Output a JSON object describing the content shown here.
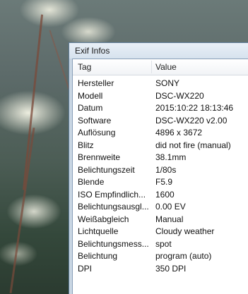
{
  "window": {
    "title": "Exif Infos"
  },
  "table": {
    "columns": [
      "Tag",
      "Value"
    ],
    "rows": [
      {
        "tag": "Hersteller",
        "value": "SONY"
      },
      {
        "tag": "Modell",
        "value": "DSC-WX220"
      },
      {
        "tag": "Datum",
        "value": "2015:10:22 18:13:46"
      },
      {
        "tag": "Software",
        "value": "DSC-WX220 v2.00"
      },
      {
        "tag": "Auflösung",
        "value": "4896 x 3672"
      },
      {
        "tag": "Blitz",
        "value": "did not fire (manual)"
      },
      {
        "tag": "Brennweite",
        "value": "38.1mm"
      },
      {
        "tag": "Belichtungszeit",
        "value": "1/80s"
      },
      {
        "tag": "Blende",
        "value": "F5.9"
      },
      {
        "tag": "ISO Empfindlich...",
        "value": "1600"
      },
      {
        "tag": "Belichtungsausgl...",
        "value": "0.00 EV"
      },
      {
        "tag": "Weißabgleich",
        "value": "Manual"
      },
      {
        "tag": "Lichtquelle",
        "value": "Cloudy weather"
      },
      {
        "tag": "Belichtungsmess...",
        "value": "spot"
      },
      {
        "tag": "Belichtung",
        "value": "program (auto)"
      },
      {
        "tag": "DPI",
        "value": "350 DPI"
      }
    ]
  }
}
